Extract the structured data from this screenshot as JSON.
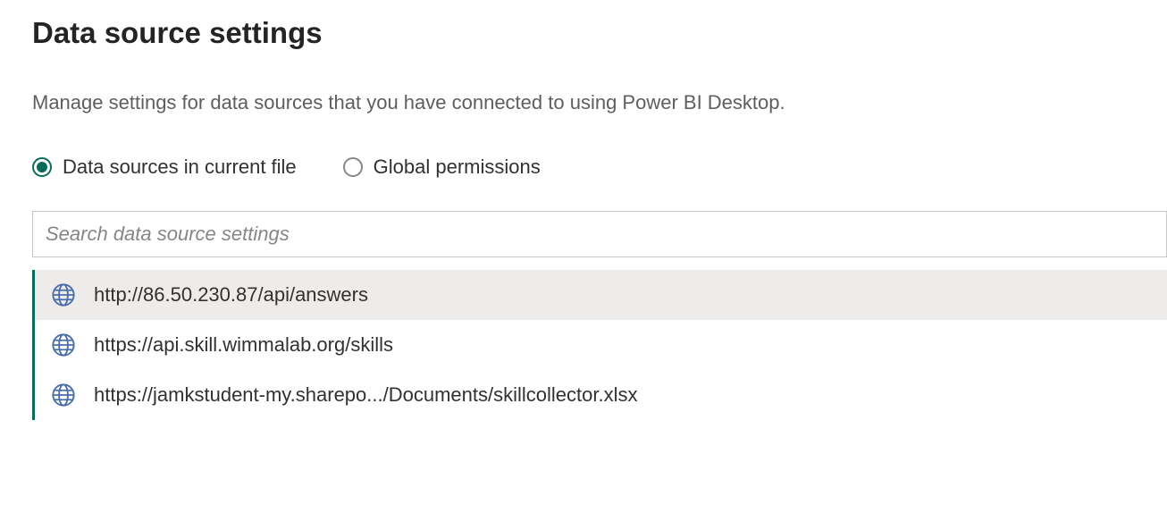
{
  "page": {
    "title": "Data source settings",
    "subtitle": "Manage settings for data sources that you have connected to using Power BI Desktop."
  },
  "radios": [
    {
      "label": "Data sources in current file",
      "selected": true
    },
    {
      "label": "Global permissions",
      "selected": false
    }
  ],
  "search": {
    "placeholder": "Search data source settings",
    "value": ""
  },
  "items": [
    {
      "label": "http://86.50.230.87/api/answers",
      "selected": true
    },
    {
      "label": "https://api.skill.wimmalab.org/skills",
      "selected": false
    },
    {
      "label": "https://jamkstudent-my.sharepo.../Documents/skillcollector.xlsx",
      "selected": false
    }
  ],
  "colors": {
    "accent": "#0b6a5a",
    "selected_bg": "#edecea",
    "border": "#c8c6c4"
  }
}
